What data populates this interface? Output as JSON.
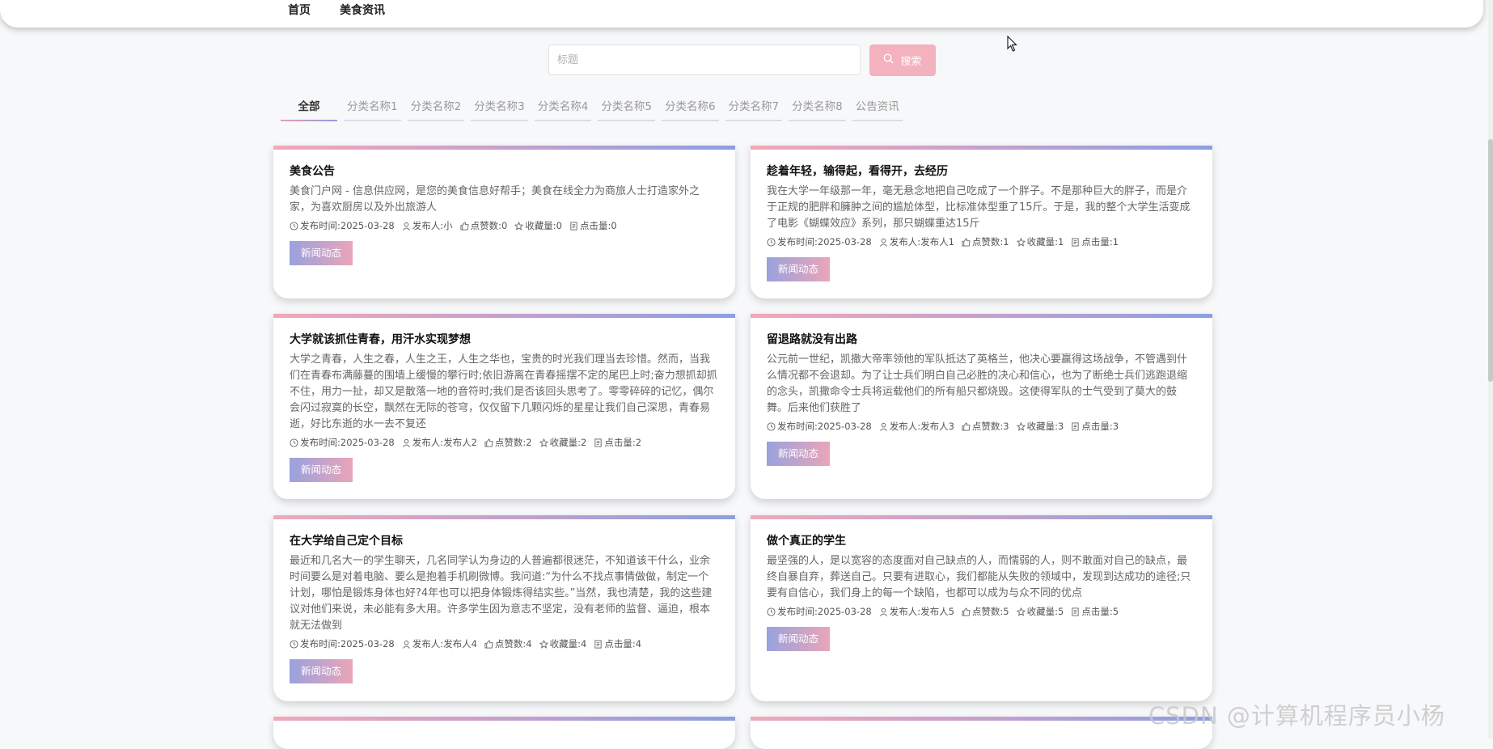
{
  "nav": {
    "items": [
      "首页",
      "美食资讯"
    ]
  },
  "search": {
    "placeholder": "标题",
    "value": "",
    "button_label": "搜索",
    "button_icon": "search-icon"
  },
  "tabs": [
    {
      "label": "全部",
      "active": true
    },
    {
      "label": "分类名称1"
    },
    {
      "label": "分类名称2"
    },
    {
      "label": "分类名称3"
    },
    {
      "label": "分类名称4"
    },
    {
      "label": "分类名称5"
    },
    {
      "label": "分类名称6"
    },
    {
      "label": "分类名称7"
    },
    {
      "label": "分类名称8"
    },
    {
      "label": "公告资讯"
    }
  ],
  "cards": [
    {
      "title": "美食公告",
      "summary": "美食门户网 - 信息供应网，是您的美食信息好帮手；美食在线全力为商旅人士打造家外之家，为喜欢厨房以及外出旅游人",
      "meta": {
        "time": "发布时间:2025-03-28",
        "author": "发布人:小",
        "likes": "点赞数:0",
        "favorites": "收藏量:0",
        "clicks": "点击量:0"
      },
      "tag": "新闻动态"
    },
    {
      "title": "趁着年轻，输得起，看得开，去经历",
      "summary": "我在大学一年级那一年，毫无悬念地把自己吃成了一个胖子。不是那种巨大的胖子，而是介于正规的肥胖和臃肿之间的尴尬体型，比标准体型重了15斤。于是，我的整个大学生活变成了电影《蝴蝶效应》系列，那只蝴蝶重达15斤",
      "meta": {
        "time": "发布时间:2025-03-28",
        "author": "发布人:发布人1",
        "likes": "点赞数:1",
        "favorites": "收藏量:1",
        "clicks": "点击量:1"
      },
      "tag": "新闻动态"
    },
    {
      "title": "大学就该抓住青春，用汗水实现梦想",
      "summary": "大学之青春，人生之春，人生之王，人生之华也，宝贵的时光我们理当去珍惜。然而，当我们在青春布满藤蔓的围墙上缓慢的攀行时;依旧游离在青春摇摆不定的尾巴上时;奋力想抓却抓不住，用力一扯，却又是散落一地的音符时;我们是否该回头思考了。零零碎碎的记忆，偶尔会闪过寂寞的长空，飘然在无际的苍穹，仅仅留下几颗闪烁的星星让我们自己深思，青春易逝，好比东逝的水一去不复还",
      "meta": {
        "time": "发布时间:2025-03-28",
        "author": "发布人:发布人2",
        "likes": "点赞数:2",
        "favorites": "收藏量:2",
        "clicks": "点击量:2"
      },
      "tag": "新闻动态"
    },
    {
      "title": "留退路就没有出路",
      "summary": "公元前一世纪，凯撒大帝率领他的军队抵达了英格兰，他决心要赢得这场战争，不管遇到什么情况都不会退却。为了让士兵们明白自己必胜的决心和信心，也为了断绝士兵们逃跑退缩的念头，凯撒命令士兵将运载他们的所有船只都烧毁。这使得军队的士气受到了莫大的鼓舞。后来他们获胜了",
      "meta": {
        "time": "发布时间:2025-03-28",
        "author": "发布人:发布人3",
        "likes": "点赞数:3",
        "favorites": "收藏量:3",
        "clicks": "点击量:3"
      },
      "tag": "新闻动态"
    },
    {
      "title": "在大学给自己定个目标",
      "summary": "最近和几名大一的学生聊天，几名同学认为身边的人普遍都很迷茫，不知道该干什么，业余时间要么是对着电脑、要么是抱着手机刷微博。我问道:“为什么不找点事情做做，制定一个计划，哪怕是锻炼身体也好?4年也可以把身体锻炼得结实些。”当然，我也清楚，我的这些建议对他们来说，未必能有多大用。许多学生因为意志不坚定，没有老师的监督、逼迫，根本就无法做到",
      "meta": {
        "time": "发布时间:2025-03-28",
        "author": "发布人:发布人4",
        "likes": "点赞数:4",
        "favorites": "收藏量:4",
        "clicks": "点击量:4"
      },
      "tag": "新闻动态"
    },
    {
      "title": "做个真正的学生",
      "summary": "最坚强的人，是以宽容的态度面对自己缺点的人，而懦弱的人，则不敢面对自己的缺点，最终自暴自弃，葬送自己。只要有进取心，我们都能从失败的领域中，发现到达成功的途径;只要有自信心，我们身上的每一个缺陷，也都可以成为与众不同的优点",
      "meta": {
        "time": "发布时间:2025-03-28",
        "author": "发布人:发布人5",
        "likes": "点赞数:5",
        "favorites": "收藏量:5",
        "clicks": "点击量:5"
      },
      "tag": "新闻动态"
    }
  ],
  "watermark": "CSDN @计算机程序员小杨"
}
